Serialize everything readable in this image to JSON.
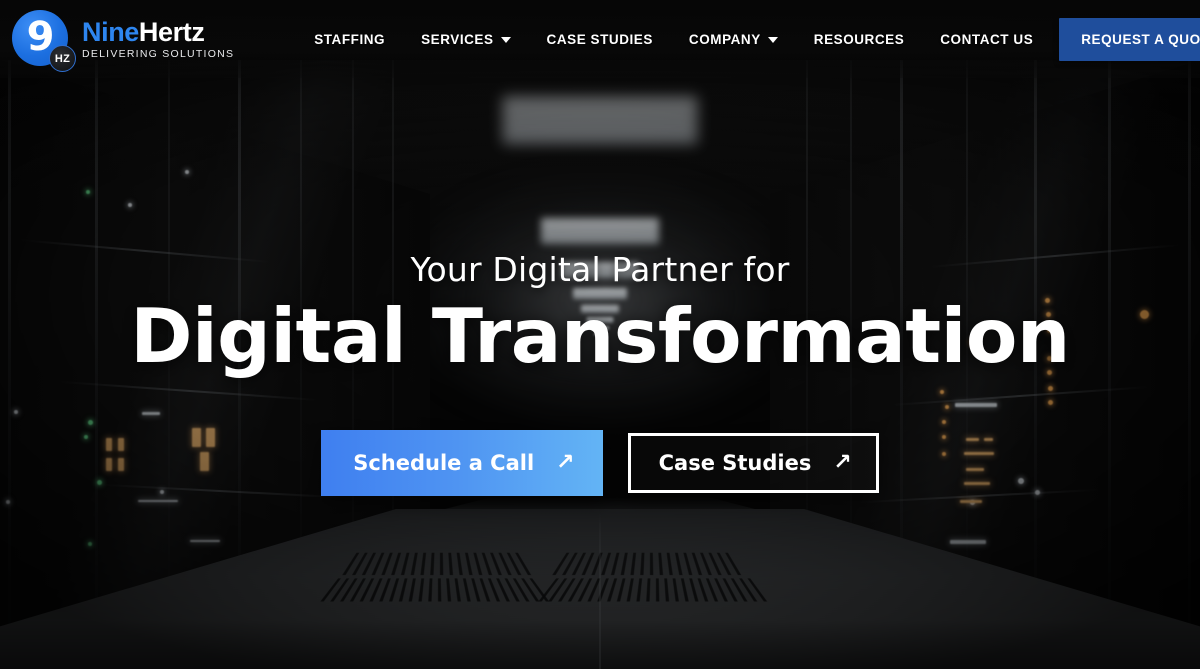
{
  "header": {
    "logo": {
      "mark_number": "9",
      "mark_badge": "HZ",
      "word_first": "Nine",
      "word_second": "Hertz",
      "tagline": "DELIVERING SOLUTIONS"
    },
    "nav_items": [
      {
        "label": "STAFFING",
        "has_dropdown": false
      },
      {
        "label": "SERVICES",
        "has_dropdown": true
      },
      {
        "label": "CASE STUDIES",
        "has_dropdown": false
      },
      {
        "label": "COMPANY",
        "has_dropdown": true
      },
      {
        "label": "RESOURCES",
        "has_dropdown": false
      },
      {
        "label": "CONTACT US",
        "has_dropdown": false
      }
    ],
    "quote_button": "REQUEST A QUOTE"
  },
  "hero": {
    "subtitle": "Your Digital Partner for",
    "title": "Digital Transformation",
    "primary_cta": {
      "label": "Schedule a Call",
      "icon": "arrow-up-right-icon"
    },
    "secondary_cta": {
      "label": "Case Studies",
      "icon": "arrow-up-right-icon"
    },
    "background_description": "data-center server room corridor at night"
  },
  "colors": {
    "brand_blue": "#2e86f0",
    "quote_button_blue": "#1f4e9c",
    "cta_gradient_start": "#3f7ff0",
    "cta_gradient_end": "#63b4f5",
    "text_white": "#ffffff",
    "background_dark": "#0a0a0a",
    "led_green": "#6ff29a",
    "led_amber": "#ffb257"
  },
  "icons": {
    "arrow_ne": "↗",
    "caret_down": "▾"
  }
}
